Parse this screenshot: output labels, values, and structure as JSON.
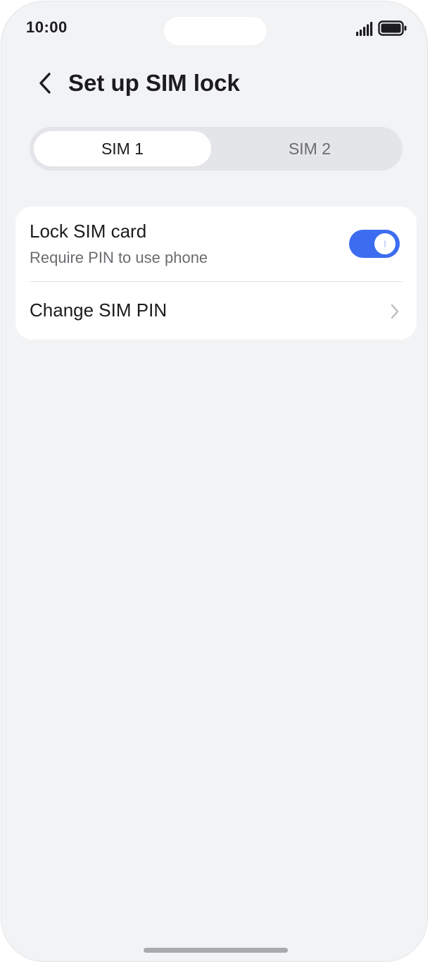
{
  "status_bar": {
    "time": "10:00"
  },
  "header": {
    "back_icon": "chevron-left-icon",
    "title": "Set up SIM lock"
  },
  "sim_tabs": {
    "selected": "SIM 1",
    "items": [
      {
        "label": "SIM 1",
        "active": true
      },
      {
        "label": "SIM 2",
        "active": false
      }
    ]
  },
  "settings": {
    "lock_sim": {
      "title": "Lock SIM card",
      "subtitle": "Require PIN to use phone",
      "enabled": true
    },
    "change_pin": {
      "title": "Change SIM PIN",
      "icon": "chevron-right-icon"
    }
  },
  "colors": {
    "accent": "#3c6cf0",
    "background": "#f2f3f5",
    "card": "#ffffff"
  }
}
